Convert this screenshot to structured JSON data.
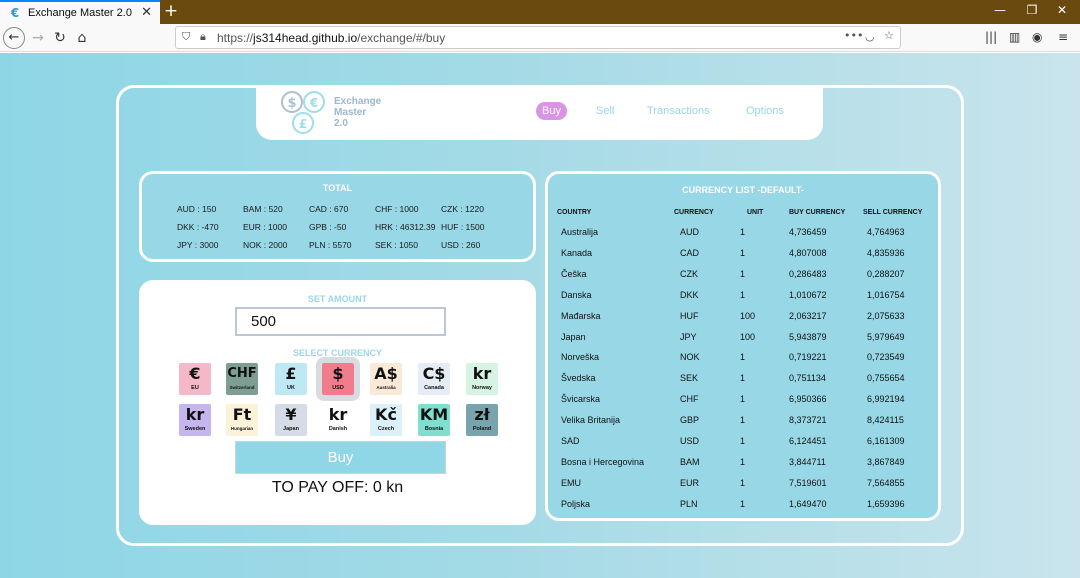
{
  "browser": {
    "tab_title": "Exchange Master 2.0",
    "favicon": "€",
    "url_prefix": "https://",
    "url_host": "js314head.github.io",
    "url_path": "/exchange/#/buy"
  },
  "app": {
    "logo_lines": [
      "Exchange",
      "Master",
      "2.0"
    ],
    "nav": [
      "Buy",
      "Sell",
      "Transactions",
      "Options"
    ],
    "active_nav": "Buy"
  },
  "total": {
    "title": "TOTAL",
    "cells": [
      "AUD : 150",
      "BAM : 520",
      "CAD : 670",
      "CHF : 1000",
      "CZK : 1220",
      "DKK : -470",
      "EUR : 1000",
      "GPB : -50",
      "HRK : 46312.39",
      "HUF : 1500",
      "JPY : 3000",
      "NOK : 2000",
      "PLN : 5570",
      "SEK : 1050",
      "USD : 260"
    ]
  },
  "buy": {
    "amount_label": "SET AMOUNT",
    "amount_value": "500",
    "select_label": "SELECT CURRENCY",
    "currencies": [
      {
        "sym": "€",
        "name": "EU",
        "color": "#f5b8c8"
      },
      {
        "sym": "CHF",
        "name": "Switzerland",
        "color": "#7f9e93"
      },
      {
        "sym": "£",
        "name": "UK",
        "color": "#bfe8f5"
      },
      {
        "sym": "$",
        "name": "USD",
        "color": "#f07c8c",
        "selected": true
      },
      {
        "sym": "A$",
        "name": "Australia",
        "color": "#fbe9d8"
      },
      {
        "sym": "C$",
        "name": "Canada",
        "color": "#e6ecf5"
      },
      {
        "sym": "kr",
        "name": "Norway",
        "color": "#d6f3e4"
      },
      {
        "sym": "kr",
        "name": "Sweden",
        "color": "#c6b6f0"
      },
      {
        "sym": "Ft",
        "name": "Hungarian",
        "color": "#fbf2d8"
      },
      {
        "sym": "¥",
        "name": "Japan",
        "color": "#d6dbe8"
      },
      {
        "sym": "kr",
        "name": "Danish",
        "color": "#ffffff"
      },
      {
        "sym": "Kč",
        "name": "Czech",
        "color": "#dcf0fa"
      },
      {
        "sym": "KM",
        "name": "Bosnia",
        "color": "#7fe0cf"
      },
      {
        "sym": "zł",
        "name": "Poland",
        "color": "#7aa4ad"
      }
    ],
    "button_label": "Buy",
    "to_pay": "TO PAY OFF: 0 kn"
  },
  "currency_list": {
    "title": "CURRENCY LIST -DEFAULT-",
    "headers": [
      "COUNTRY",
      "CURRENCY",
      "UNIT",
      "BUY CURRENCY",
      "SELL CURRENCY"
    ],
    "rows": [
      [
        "Australija",
        "AUD",
        "1",
        "4,736459",
        "4,764963"
      ],
      [
        "Kanada",
        "CAD",
        "1",
        "4,807008",
        "4,835936"
      ],
      [
        "Češka",
        "CZK",
        "1",
        "0,286483",
        "0,288207"
      ],
      [
        "Danska",
        "DKK",
        "1",
        "1,010672",
        "1,016754"
      ],
      [
        "Mađarska",
        "HUF",
        "100",
        "2,063217",
        "2,075633"
      ],
      [
        "Japan",
        "JPY",
        "100",
        "5,943879",
        "5,979649"
      ],
      [
        "Norveška",
        "NOK",
        "1",
        "0,719221",
        "0,723549"
      ],
      [
        "Švedska",
        "SEK",
        "1",
        "0,751134",
        "0,755654"
      ],
      [
        "Švicarska",
        "CHF",
        "1",
        "6,950366",
        "6,992194"
      ],
      [
        "Velika Britanija",
        "GBP",
        "1",
        "8,373721",
        "8,424115"
      ],
      [
        "SAD",
        "USD",
        "1",
        "6,124451",
        "6,161309"
      ],
      [
        "Bosna i Hercegovina",
        "BAM",
        "1",
        "3,844711",
        "3,867849"
      ],
      [
        "EMU",
        "EUR",
        "1",
        "7,519601",
        "7,564855"
      ],
      [
        "Poljska",
        "PLN",
        "1",
        "1,649470",
        "1,659396"
      ]
    ]
  }
}
